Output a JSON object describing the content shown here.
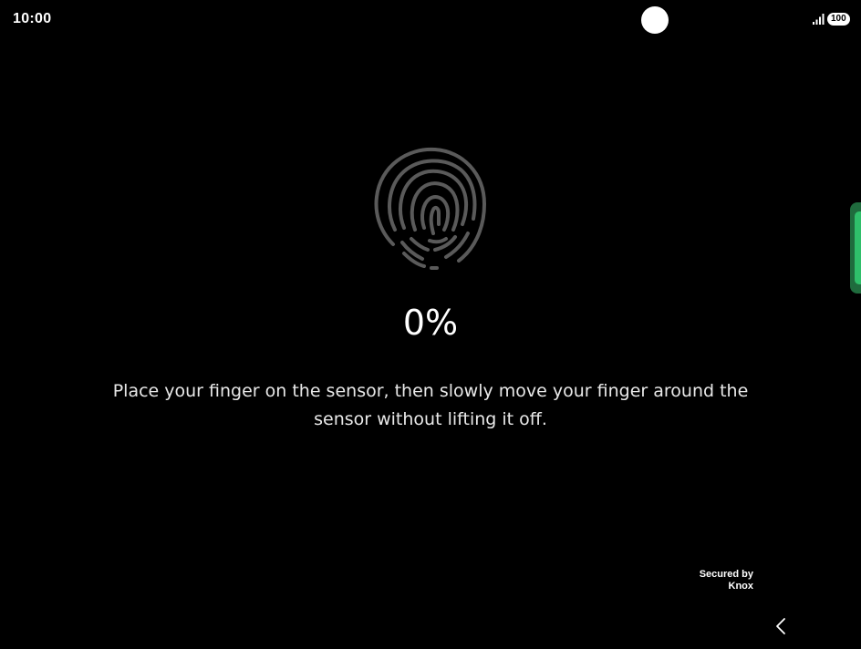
{
  "status_bar": {
    "time": "10:00",
    "battery": "100",
    "signal_icon": "signal-icon",
    "camera_icon": "camera-cutout-icon"
  },
  "enrollment": {
    "icon": "fingerprint-icon",
    "progress": "0%",
    "progress_value": 0,
    "instruction": "Place your finger on the sensor, then slowly move your finger around the sensor without lifting it off."
  },
  "footer": {
    "secured_line1": "Secured by",
    "secured_line2": "Knox",
    "back_icon": "back-chevron-icon"
  },
  "colors": {
    "background": "#000000",
    "text": "#ffffff",
    "fingerprint_stroke": "#5a5a5a",
    "edge_handle": "#2fbf6a"
  }
}
